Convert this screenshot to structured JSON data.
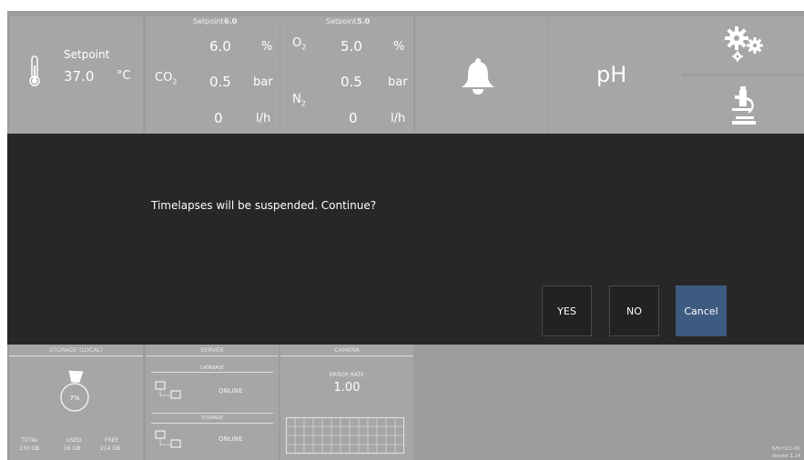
{
  "temperature": {
    "setpoint_label": "Setpoint",
    "value": "37.0",
    "unit": "°C"
  },
  "gas_co2": {
    "setpoint_label": "Setpoint",
    "setpoint_value": "6.0",
    "gas_label": "CO",
    "gas_sub": "2",
    "rows": [
      {
        "value": "6.0",
        "unit": "%"
      },
      {
        "value": "0.5",
        "unit": "bar"
      },
      {
        "value": "0",
        "unit": "l/h"
      }
    ]
  },
  "gas_o2_n2": {
    "setpoint_label": "Setpoint",
    "setpoint_value": "5.0",
    "o2_label": "O",
    "o2_sub": "2",
    "n2_label": "N",
    "n2_sub": "2",
    "rows": [
      {
        "value": "5.0",
        "unit": "%"
      },
      {
        "value": "0.5",
        "unit": "bar"
      },
      {
        "value": "0",
        "unit": "l/h"
      }
    ]
  },
  "ph": {
    "label": "pH"
  },
  "icons": {
    "thermometer": "thermometer-icon",
    "bell": "bell-icon",
    "gears": "gears-icon",
    "microscope": "microscope-icon"
  },
  "dialog": {
    "message": "Timelapses will be suspended. Continue?",
    "yes_label": "YES",
    "no_label": "NO",
    "cancel_label": "Cancel"
  },
  "storage": {
    "title": "STORAGE (LOCAL)",
    "percent_label": "7%",
    "percent_used": 0.07,
    "total_label": "TOTAL",
    "total_value": "230 GB",
    "used_label": "USED",
    "used_value": "16 GB",
    "free_label": "FREE",
    "free_value": "214 GB"
  },
  "server": {
    "title": "SERVER",
    "database_label": "DATABASE",
    "database_status": "ONLINE",
    "storage_label": "STORAGE",
    "storage_status": "ONLINE"
  },
  "camera": {
    "title": "CAMERA",
    "error_rate_label": "ERROR RATE",
    "error_rate_value": "1.00"
  },
  "device": {
    "serial": "S/N H11-00",
    "version": "Version 1.14"
  },
  "colors": {
    "background": "#9c9c9c",
    "tile": "#a6a6a6",
    "dialog": "#272727",
    "accent": "#3d5a80"
  }
}
